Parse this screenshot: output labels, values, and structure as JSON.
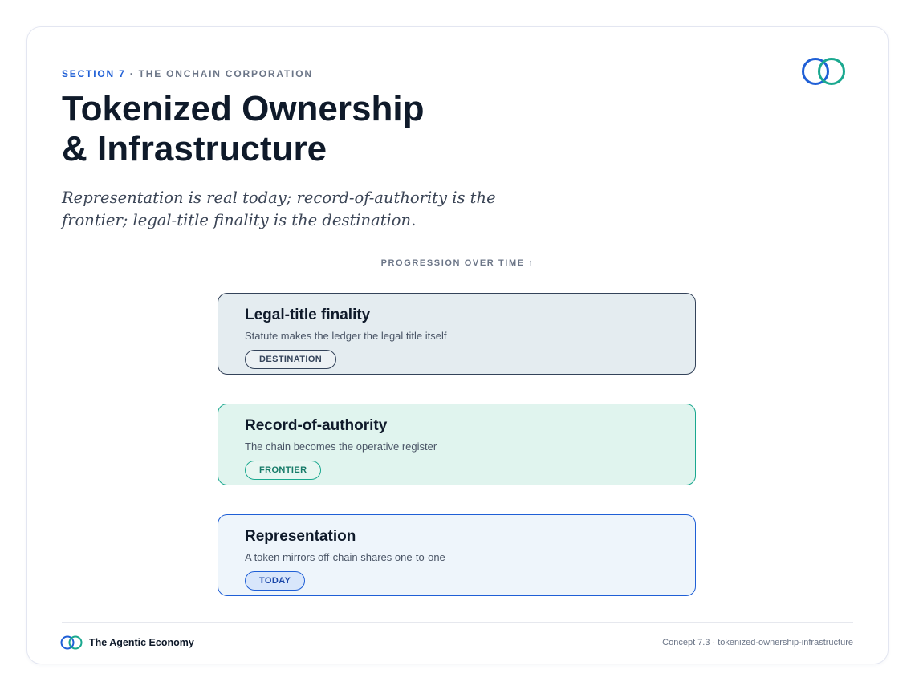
{
  "header": {
    "section": "SECTION 7",
    "section_context": "· THE ONCHAIN CORPORATION",
    "title_line1": "Tokenized Ownership",
    "title_line2": "& Infrastructure",
    "subtitle": "Representation is real today; record-of-authority is the frontier; legal-title finality is the destination.",
    "logo_icon": "interlocking-rings-icon"
  },
  "diagram": {
    "axis_label": "PROGRESSION OVER TIME ↑",
    "stages": [
      {
        "title": "Legal-title finality",
        "description": "Statute makes the ledger the legal title itself",
        "badge": "DESTINATION",
        "accent": "#34435a"
      },
      {
        "title": "Record-of-authority",
        "description": "The chain becomes the operative register",
        "badge": "FRONTIER",
        "accent": "#1aa88f"
      },
      {
        "title": "Representation",
        "description": "A token mirrors off-chain shares one-to-one",
        "badge": "TODAY",
        "accent": "#1f5fd6"
      }
    ]
  },
  "footer": {
    "brand": "The Agentic Economy",
    "meta": "Concept 7.3 · tokenized-ownership-infrastructure",
    "logo_icon": "interlocking-rings-icon"
  },
  "colors": {
    "brand_blue": "#1f5fd6",
    "brand_teal": "#1aa88f",
    "ink": "#0f1a2a",
    "muted": "#6b7587"
  }
}
